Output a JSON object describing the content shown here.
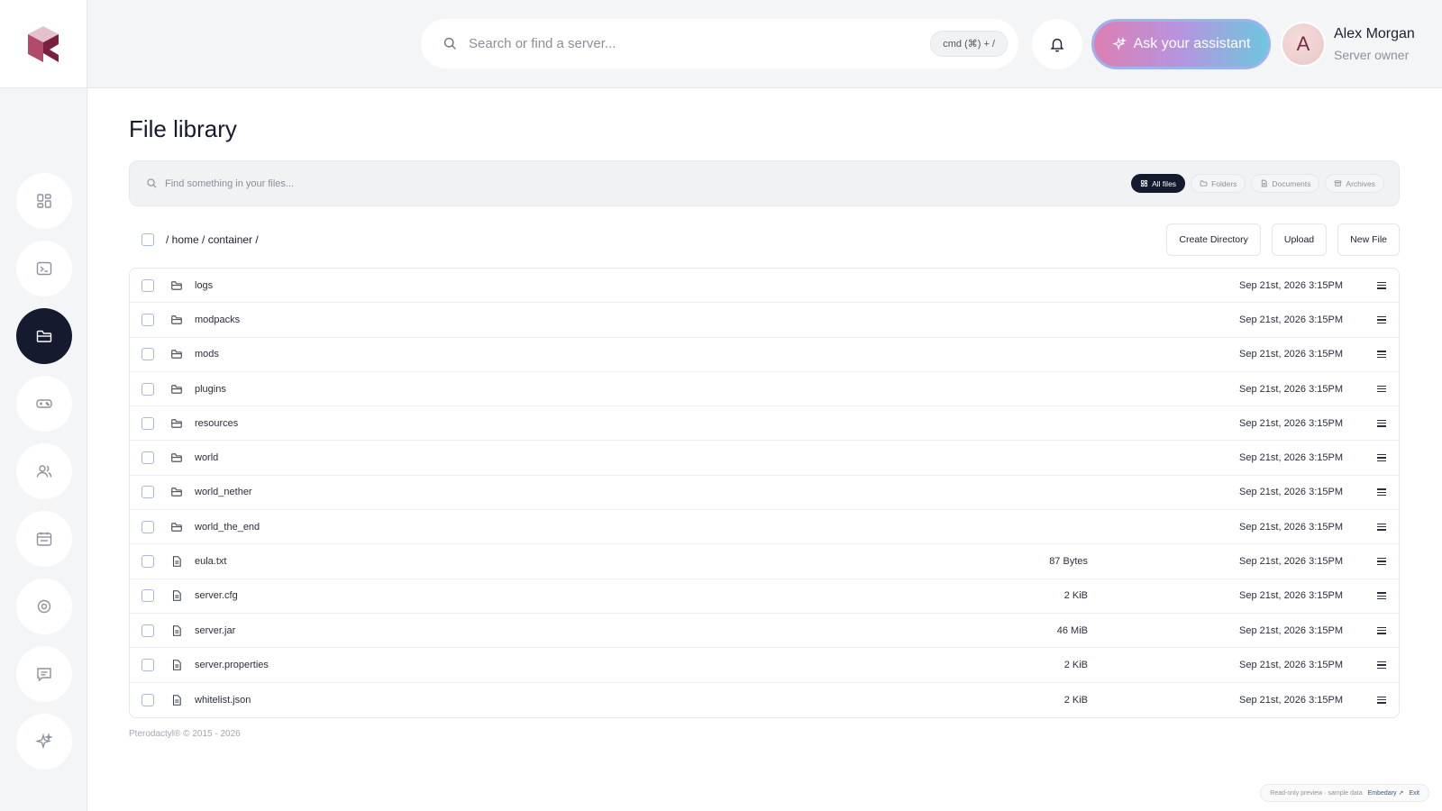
{
  "app": {
    "brand_colors": {
      "accent": "#161a2e",
      "logo_primary": "#8a2a4a",
      "logo_light": "#e5c1cc"
    }
  },
  "sidebar": {
    "items": [
      {
        "name": "dashboard",
        "icon": "grid-icon"
      },
      {
        "name": "console",
        "icon": "terminal-icon"
      },
      {
        "name": "files",
        "icon": "folder-open-icon",
        "active": true
      },
      {
        "name": "games",
        "icon": "gamepad-icon"
      },
      {
        "name": "users",
        "icon": "users-icon"
      },
      {
        "name": "schedules",
        "icon": "calendar-icon"
      },
      {
        "name": "settings",
        "icon": "settings-icon"
      },
      {
        "name": "messages",
        "icon": "message-icon"
      },
      {
        "name": "ai",
        "icon": "sparkles-icon"
      }
    ]
  },
  "topbar": {
    "search_placeholder": "Search or find a server...",
    "shortcut": "cmd (⌘) + /",
    "assistant_label": "Ask your assistant"
  },
  "user": {
    "initial": "A",
    "name": "Alex Morgan",
    "role": "Server owner"
  },
  "page": {
    "title": "File library",
    "filter_placeholder": "Find something in your files...",
    "filters": [
      {
        "label": "All files",
        "active": true
      },
      {
        "label": "Folders",
        "active": false
      },
      {
        "label": "Documents",
        "active": false
      },
      {
        "label": "Archives",
        "active": false
      }
    ],
    "breadcrumb": "/ home / container /",
    "actions": {
      "create_directory": "Create Directory",
      "upload": "Upload",
      "new_file": "New File"
    }
  },
  "files": [
    {
      "name": "logs",
      "type": "folder",
      "size": "",
      "date": "Sep 21st, 2026 3:15PM"
    },
    {
      "name": "modpacks",
      "type": "folder",
      "size": "",
      "date": "Sep 21st, 2026 3:15PM"
    },
    {
      "name": "mods",
      "type": "folder",
      "size": "",
      "date": "Sep 21st, 2026 3:15PM"
    },
    {
      "name": "plugins",
      "type": "folder",
      "size": "",
      "date": "Sep 21st, 2026 3:15PM"
    },
    {
      "name": "resources",
      "type": "folder",
      "size": "",
      "date": "Sep 21st, 2026 3:15PM"
    },
    {
      "name": "world",
      "type": "folder",
      "size": "",
      "date": "Sep 21st, 2026 3:15PM"
    },
    {
      "name": "world_nether",
      "type": "folder",
      "size": "",
      "date": "Sep 21st, 2026 3:15PM"
    },
    {
      "name": "world_the_end",
      "type": "folder",
      "size": "",
      "date": "Sep 21st, 2026 3:15PM"
    },
    {
      "name": "eula.txt",
      "type": "file",
      "size": "87 Bytes",
      "date": "Sep 21st, 2026 3:15PM"
    },
    {
      "name": "server.cfg",
      "type": "file",
      "size": "2 KiB",
      "date": "Sep 21st, 2026 3:15PM"
    },
    {
      "name": "server.jar",
      "type": "file",
      "size": "46 MiB",
      "date": "Sep 21st, 2026 3:15PM"
    },
    {
      "name": "server.properties",
      "type": "file",
      "size": "2 KiB",
      "date": "Sep 21st, 2026 3:15PM"
    },
    {
      "name": "whitelist.json",
      "type": "file",
      "size": "2 KiB",
      "date": "Sep 21st, 2026 3:15PM"
    }
  ],
  "footer": {
    "copyright": "Pterodactyl® © 2015 - 2026",
    "preview_note": "Read-only preview · sample data",
    "preview_link": "Embedary ↗",
    "exit": "Exit"
  }
}
